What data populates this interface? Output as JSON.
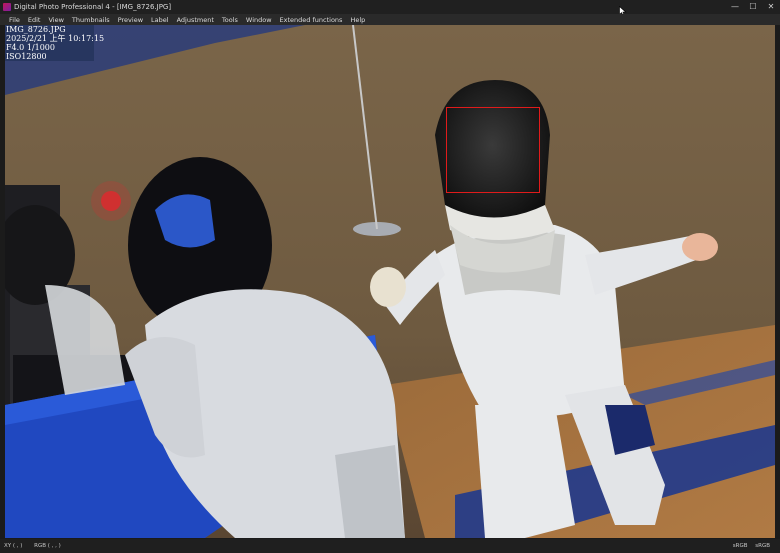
{
  "window": {
    "title": "Digital Photo Professional 4 - [IMG_8726.JPG]",
    "controls": {
      "minimize": "—",
      "maximize": "☐",
      "close": "✕"
    }
  },
  "menu": {
    "items": [
      "File",
      "Edit",
      "View",
      "Thumbnails",
      "Preview",
      "Label",
      "Adjustment",
      "Tools",
      "Window",
      "Extended functions",
      "Help"
    ]
  },
  "image_info": {
    "filename": "IMG_8726.JPG",
    "datetime": "2025/2/21 上午 10:17:15",
    "exposure": "F4.0 1/1000",
    "iso": "ISO12800"
  },
  "status": {
    "coords": "XY (   ,   )",
    "rgb_readout": "RGB (   ,   ,   )",
    "color_space_1": "sRGB",
    "color_space_2": "sRGB"
  },
  "icons": {
    "app": "app-icon",
    "cursor": "mouse-pointer-icon"
  },
  "colors": {
    "af_frame": "#e01b1b",
    "info_overlay_bg": "#26345c"
  }
}
